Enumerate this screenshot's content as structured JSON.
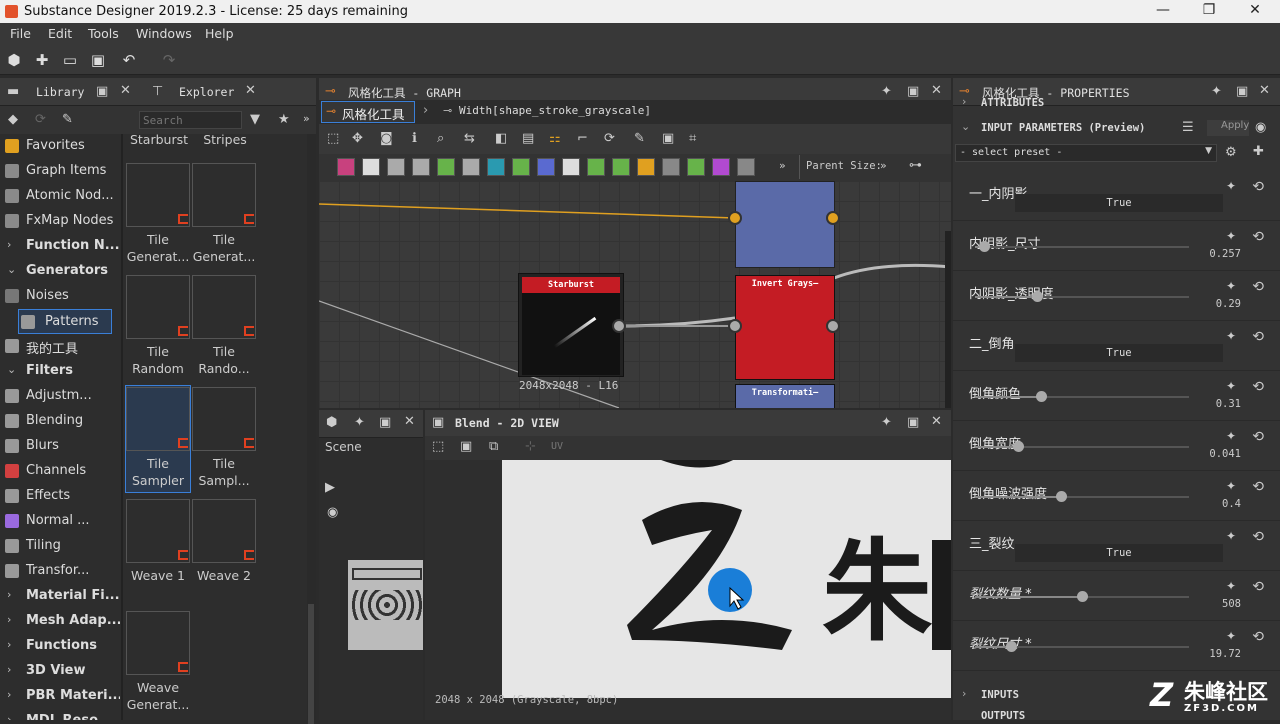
{
  "window": {
    "title": "Substance Designer 2019.2.3 - License: 25 days remaining"
  },
  "menu": [
    "File",
    "Edit",
    "Tools",
    "Windows",
    "Help"
  ],
  "library": {
    "tabs": [
      "Library",
      "Explorer"
    ],
    "search_placeholder": "Search",
    "categories": [
      {
        "label": "Favorites",
        "type": "item",
        "color": "#e0a020"
      },
      {
        "label": "Graph Items",
        "type": "item",
        "color": "#8a8a8a"
      },
      {
        "label": "Atomic Nod...",
        "type": "item",
        "color": "#8a8a8a"
      },
      {
        "label": "FxMap Nodes",
        "type": "item",
        "color": "#8a8a8a"
      },
      {
        "label": "Function N...",
        "type": "group",
        "arrow": "›"
      },
      {
        "label": "Generators",
        "type": "group",
        "arrow": "⌄"
      },
      {
        "label": "Noises",
        "type": "item",
        "color": "#777"
      },
      {
        "label": "Patterns",
        "type": "item",
        "color": "#999",
        "selected": true
      },
      {
        "label": "我的工具",
        "type": "item",
        "color": "#999"
      },
      {
        "label": "Filters",
        "type": "group",
        "arrow": "⌄"
      },
      {
        "label": "Adjustm...",
        "type": "item",
        "color": "#999"
      },
      {
        "label": "Blending",
        "type": "item",
        "color": "#999"
      },
      {
        "label": "Blurs",
        "type": "item",
        "color": "#999"
      },
      {
        "label": "Channels",
        "type": "item",
        "color": "#d24040"
      },
      {
        "label": "Effects",
        "type": "item",
        "color": "#999"
      },
      {
        "label": "Normal ...",
        "type": "item",
        "color": "#9a6adf"
      },
      {
        "label": "Tiling",
        "type": "item",
        "color": "#999"
      },
      {
        "label": "Transfor...",
        "type": "item",
        "color": "#999"
      },
      {
        "label": "Material Fi...",
        "type": "group",
        "arrow": "›"
      },
      {
        "label": "Mesh Adap...",
        "type": "group",
        "arrow": "›"
      },
      {
        "label": "Functions",
        "type": "group",
        "arrow": "›"
      },
      {
        "label": "3D View",
        "type": "group",
        "arrow": "›"
      },
      {
        "label": "PBR Materi...",
        "type": "group",
        "arrow": "›"
      },
      {
        "label": "MDL Reso...",
        "type": "group",
        "arrow": "›"
      }
    ],
    "top_labels": [
      "Starburst",
      "Stripes"
    ],
    "items": [
      {
        "label": "Tile\nGenerat...",
        "style": "white-grid"
      },
      {
        "label": "Tile\nGenerat...",
        "style": "blue-grid"
      },
      {
        "label": "Tile\nRandom",
        "style": "white-brick"
      },
      {
        "label": "Tile\nRando...",
        "style": "blue-brick"
      },
      {
        "label": "Tile\nSampler",
        "style": "white-dots",
        "selected": true
      },
      {
        "label": "Tile\nSampl...",
        "style": "blue-dots"
      },
      {
        "label": "Weave 1",
        "style": "weave1"
      },
      {
        "label": "Weave 2",
        "style": "weave2"
      },
      {
        "label": "Weave\nGenerat...",
        "style": "weave3"
      }
    ]
  },
  "graph": {
    "title": "风格化工具 - GRAPH",
    "breadcrumb": [
      "风格化工具",
      "Width[shape_stroke_grayscale]"
    ],
    "parent_size_label": "Parent Size:",
    "nodes": {
      "starburst": {
        "title": "Starburst",
        "size": "2048x2048 - L16",
        "color": "#c41c24"
      },
      "invert": {
        "title": "Invert Grays—",
        "color": "#c41c24"
      },
      "transform": {
        "title": "Transformati—",
        "color": "#c41c24"
      }
    }
  },
  "scene": {
    "label": "Scene"
  },
  "view2d": {
    "title": "Blend - 2D VIEW",
    "channel": "UV",
    "status": "2048 x 2048 (Grayscale, 8bpc)"
  },
  "properties": {
    "title": "风格化工具 - PROPERTIES",
    "attributes": "ATTRIBUTES",
    "input_params": "INPUT PARAMETERS (Preview)",
    "apply": "Apply",
    "preset": "- select preset -",
    "params": [
      {
        "label": "一_内阴影",
        "kind": "bool",
        "value": "True"
      },
      {
        "label": "内阴影_尺寸",
        "kind": "slider",
        "value": "0.257",
        "pos": 0.04
      },
      {
        "label": "内阴影_透明度",
        "kind": "slider",
        "value": "0.29",
        "pos": 0.29
      },
      {
        "label": "二_倒角",
        "kind": "bool",
        "value": "True"
      },
      {
        "label": "倒角颜色",
        "kind": "slider",
        "value": "0.31",
        "pos": 0.31
      },
      {
        "label": "倒角宽度",
        "kind": "slider",
        "value": "0.041",
        "pos": 0.2
      },
      {
        "label": "倒角噪波强度",
        "kind": "slider",
        "value": "0.4",
        "pos": 0.4
      },
      {
        "label": "三_裂纹",
        "kind": "bool",
        "value": "True"
      },
      {
        "label": "裂纹数量 *",
        "kind": "slider",
        "value": "508",
        "pos": 0.5,
        "italic": true
      },
      {
        "label": "裂纹尺寸 *",
        "kind": "slider",
        "value": "19.72",
        "pos": 0.17,
        "italic": true
      }
    ],
    "inputs": "INPUTS",
    "outputs": "OUTPUTS"
  },
  "watermark": {
    "logo": "Z",
    "text": "朱峰社区",
    "url": "ZF3D.COM"
  }
}
